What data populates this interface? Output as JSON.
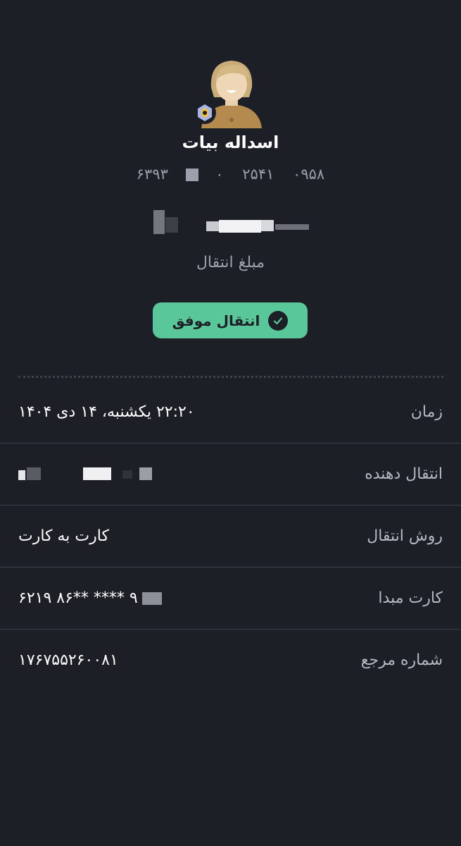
{
  "recipient": {
    "name": "اسداله بیات",
    "card_part_1": "۶۳۹۳",
    "card_part_2": "۰",
    "card_part_3": "۲۵۴۱",
    "card_part_4": "۰۹۵۸"
  },
  "transfer": {
    "amount_label": "مبلغ انتقال",
    "status": "انتقال موفق"
  },
  "details": {
    "time_label": "زمان",
    "time_value": "۲۲:۲۰ یکشنبه، ۱۴ دی ۱۴۰۴",
    "sender_label": "انتقال دهنده",
    "method_label": "روش انتقال",
    "method_value": "کارت به کارت",
    "source_card_label": "کارت مبدا",
    "source_card_value": "۶۲۱۹  ۸۶** ****  ۹",
    "reference_label": "شماره مرجع",
    "reference_value": "۱۷۶۷۵۵۲۶۰۰۸۱"
  },
  "colors": {
    "background": "#1d1f27",
    "success": "#5ac79a",
    "muted_text": "#9da0ab"
  },
  "icons": {
    "avatar": "male-avatar-icon",
    "bank": "bank-logo-icon",
    "status": "check-icon"
  }
}
